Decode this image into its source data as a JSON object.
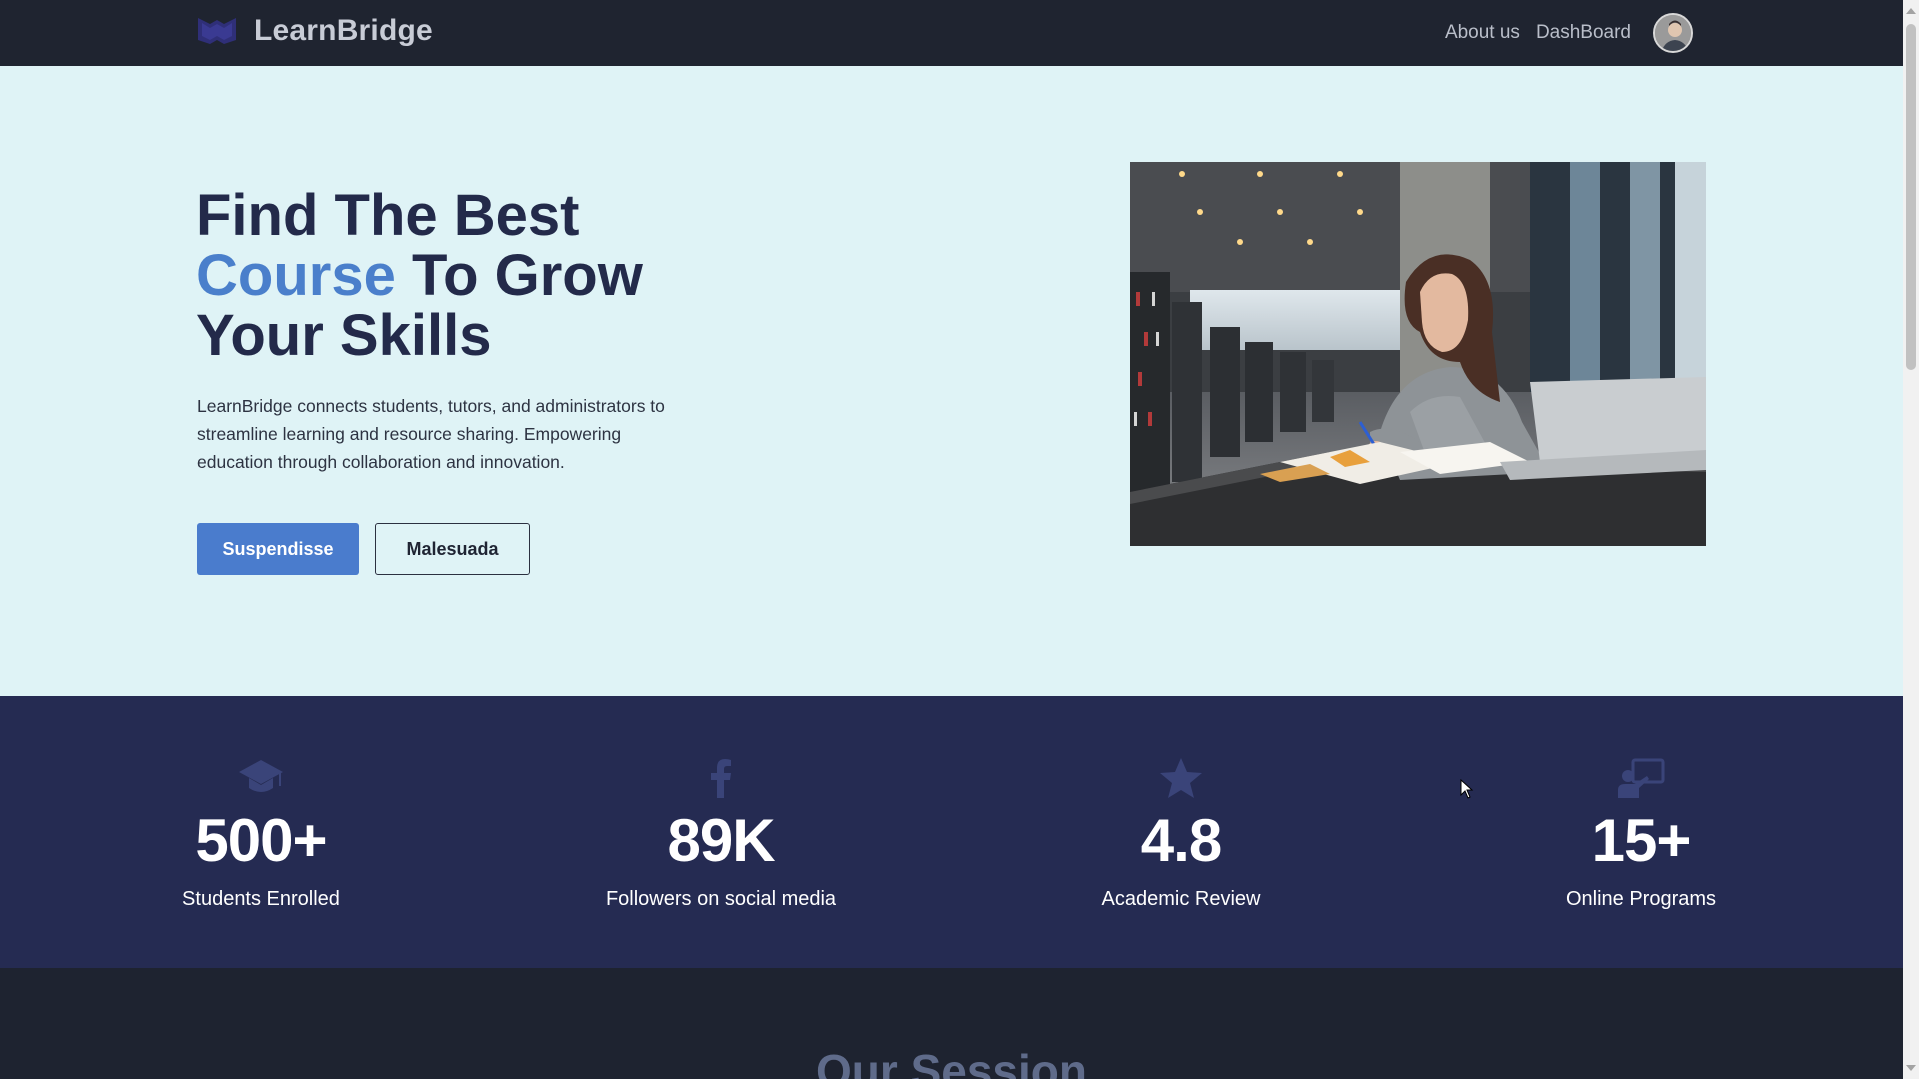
{
  "nav": {
    "brand": "LearnBridge",
    "links": [
      "About us",
      "DashBoard"
    ]
  },
  "hero": {
    "title_line1": "Find The Best",
    "title_accent": "Course",
    "title_line2_rest": " To Grow",
    "title_line3": "Your Skills",
    "description": "LearnBridge connects students, tutors, and administrators to streamline learning and resource sharing. Empowering education through collaboration and innovation.",
    "primary_button": "Suspendisse",
    "secondary_button": "Malesuada"
  },
  "stats": [
    {
      "icon": "graduation-cap-icon",
      "value": "500+",
      "label": "Students Enrolled"
    },
    {
      "icon": "facebook-icon",
      "value": "89K",
      "label": "Followers on social media"
    },
    {
      "icon": "star-icon",
      "value": "4.8",
      "label": "Academic Review"
    },
    {
      "icon": "teacher-board-icon",
      "value": "15+",
      "label": "Online Programs"
    }
  ],
  "session": {
    "title": "Our Session"
  },
  "colors": {
    "nav_bg": "#1f2430",
    "hero_bg": "#dff3f6",
    "accent": "#4a7fcb",
    "stats_bg": "#252b52",
    "heading": "#232a4a"
  }
}
